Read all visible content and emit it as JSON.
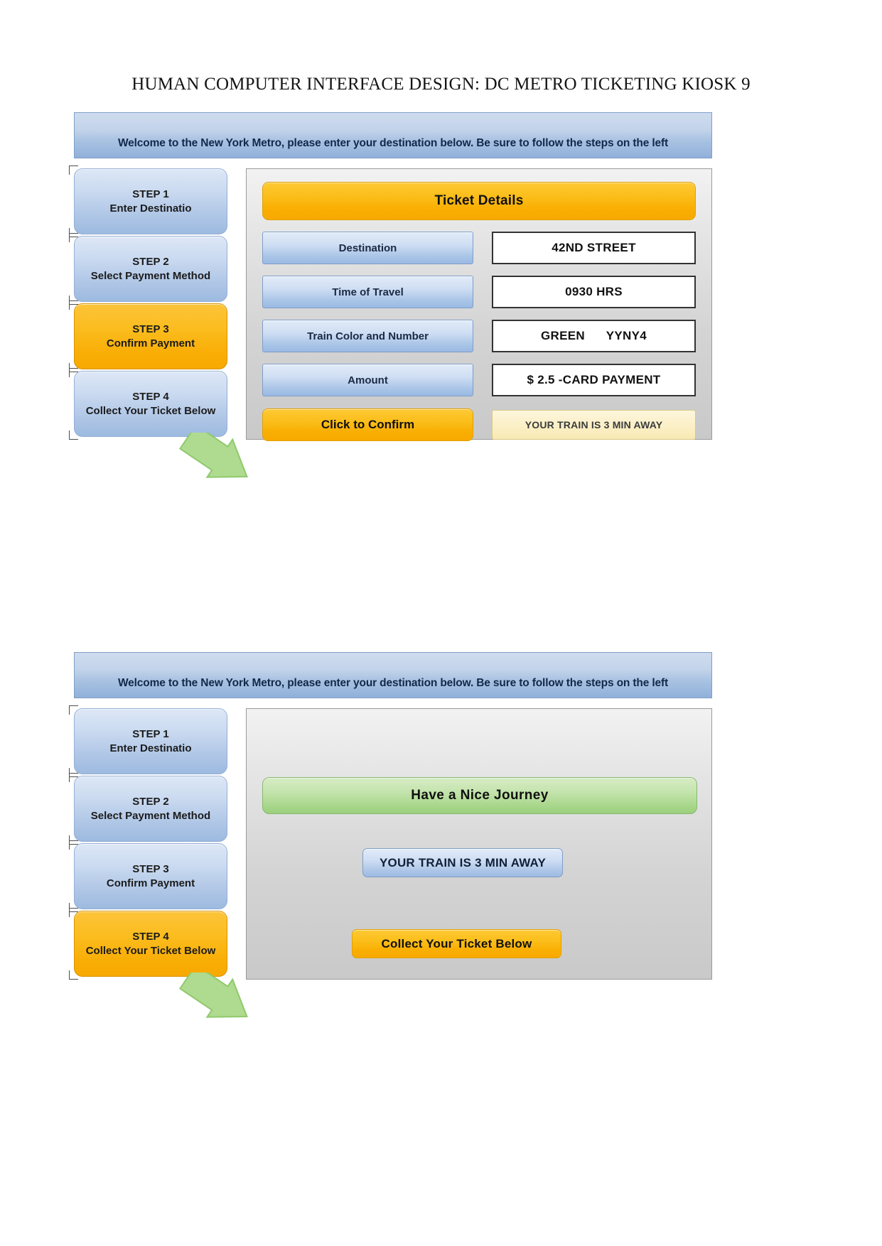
{
  "document": {
    "running_header": "HUMAN COMPUTER INTERFACE DESIGN: DC METRO TICKETING KIOSK 9"
  },
  "colors": {
    "accent_orange": "#f9ae02",
    "accent_blue": "#9dbae0",
    "accent_green": "#a9d78c",
    "panel_gray": "#d4d4d4",
    "status_cream": "#fbf0c8"
  },
  "screen1": {
    "banner": {
      "text": "Welcome to the New York Metro, please enter your destination below. Be sure to follow the steps on the left"
    },
    "steps": [
      {
        "number": "STEP 1",
        "label": "Enter Destinatio",
        "state": "blue"
      },
      {
        "number": "STEP 2",
        "label": "Select Payment Method",
        "state": "blue"
      },
      {
        "number": "STEP 3",
        "label": "Confirm Payment",
        "state": "orange"
      },
      {
        "number": "STEP 4",
        "label": "Collect Your Ticket Below",
        "state": "blue"
      }
    ],
    "panel": {
      "title": "Ticket Details",
      "rows": [
        {
          "label": "Destination",
          "value": "42ND STREET"
        },
        {
          "label": "Time of Travel",
          "value": "0930 HRS"
        },
        {
          "label": "Train Color and Number",
          "value": "GREEN      YYNY4"
        },
        {
          "label": "Amount",
          "value": "$ 2.5 -CARD PAYMENT"
        }
      ],
      "confirm_button": "Click to Confirm",
      "train_status": "YOUR TRAIN IS 3 MIN AWAY"
    },
    "arrow_icon": "green-arrow-icon"
  },
  "screen2": {
    "banner": {
      "text": "Welcome to the New York Metro, please enter your destination below. Be sure to follow the steps on the left"
    },
    "steps": [
      {
        "number": "STEP 1",
        "label": "Enter Destinatio",
        "state": "blue"
      },
      {
        "number": "STEP 2",
        "label": "Select Payment Method",
        "state": "blue"
      },
      {
        "number": "STEP 3",
        "label": "Confirm Payment",
        "state": "blue"
      },
      {
        "number": "STEP 4",
        "label": "Collect Your Ticket Below",
        "state": "orange"
      }
    ],
    "panel": {
      "journey_message": "Have a Nice Journey",
      "train_status": "YOUR TRAIN IS 3 MIN AWAY",
      "collect_button": "Collect Your Ticket Below"
    },
    "arrow_icon": "green-arrow-icon"
  }
}
